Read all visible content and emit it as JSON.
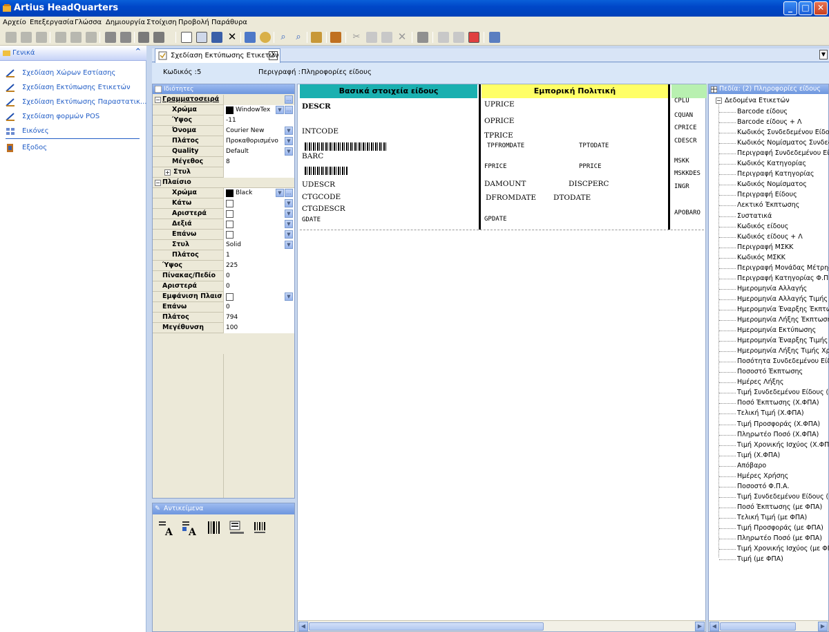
{
  "window": {
    "title": "Artius HeadQuarters",
    "min": "_",
    "max": "□",
    "close": "✕"
  },
  "menu": [
    "Αρχείο",
    "Επεξεργασία",
    "Γλώσσα",
    "Δημιουργία",
    "Στοίχιση",
    "Προβολή",
    "Παράθυρα"
  ],
  "left_panel": {
    "title": "Γενικά",
    "collapse": "^",
    "items": [
      {
        "label": "Σχεδίαση Χώρων Εστίασης",
        "icon": "design-icon"
      },
      {
        "label": "Σχεδίαση Εκτύπωσης Ετικετών",
        "icon": "design-icon"
      },
      {
        "label": "Σχεδίαση Εκτύπωσης Παραστατικ...",
        "icon": "design-icon"
      },
      {
        "label": "Σχεδίαση φορμών POS",
        "icon": "design-icon"
      },
      {
        "label": "Εικόνες",
        "icon": "grid-icon"
      },
      {
        "label": "Εξοδος",
        "icon": "exit-icon"
      }
    ]
  },
  "doc_tab": {
    "label": "Σχεδίαση Εκτύπωσης Ετικετών",
    "close": "X"
  },
  "info": {
    "code_label": "Κωδικός :",
    "code_value": "5",
    "desc_label": "Περιγραφή :",
    "desc_value": "Πληροφορίες είδους"
  },
  "properties": {
    "title": "Ιδιότητες",
    "font_section": "Γραμματοσειρά",
    "font_rows": [
      {
        "name": "Χρώμα",
        "value": "WindowTex",
        "swatch": "#000000",
        "type": "color"
      },
      {
        "name": "Ύψος",
        "value": "-11"
      },
      {
        "name": "Όνομα",
        "value": "Courier New",
        "type": "dropdown"
      },
      {
        "name": "Πλάτος",
        "value": "Προκαθορισμένο",
        "type": "dropdown"
      },
      {
        "name": "Quality",
        "value": "Default",
        "type": "dropdown"
      },
      {
        "name": "Μέγεθος",
        "value": "8"
      }
    ],
    "style_label": "Στυλ",
    "frame_section": "Πλαίσιο",
    "frame_rows": [
      {
        "name": "Χρώμα",
        "value": "Black",
        "swatch": "#000000",
        "type": "color"
      },
      {
        "name": "Κάτω",
        "value": "",
        "type": "checkbox"
      },
      {
        "name": "Αριστερά",
        "value": "",
        "type": "checkbox"
      },
      {
        "name": "Δεξιά",
        "value": "",
        "type": "checkbox"
      },
      {
        "name": "Επάνω",
        "value": "",
        "type": "checkbox"
      },
      {
        "name": "Στυλ",
        "value": "Solid",
        "type": "dropdown"
      },
      {
        "name": "Πλάτος",
        "value": "1"
      }
    ],
    "root_rows": [
      {
        "name": "Ύψος",
        "value": "225"
      },
      {
        "name": "Πίνακας/Πεδίο",
        "value": "0"
      },
      {
        "name": "Αριστερά",
        "value": "0"
      },
      {
        "name": "Εμφάνιση Πλαισί",
        "value": "",
        "type": "checkbox"
      },
      {
        "name": "Επάνω",
        "value": "0"
      },
      {
        "name": "Πλάτος",
        "value": "794"
      },
      {
        "name": "Μεγέθυνση",
        "value": "100"
      }
    ]
  },
  "objects_panel": {
    "title": "Αντικείμενα"
  },
  "label_design": {
    "band1": "Βασικά στοιχεία είδους",
    "band2": "Εμπορική Πολιτική",
    "fields1": [
      "DESCR",
      "INTCODE",
      "BARC",
      "UDESCR",
      "CTGCODE",
      "CTGDESCR",
      "GDATE"
    ],
    "fields2": [
      "UPRICE",
      "OPRICE",
      "TPRICE",
      "TPFROMDATE",
      "TPTODATE",
      "FPRICE",
      "PPRICE",
      "DAMOUNT",
      "DISCPERC",
      "DFROMDATE",
      "DTODATE",
      "GPDATE"
    ],
    "fields3": [
      "CPLU",
      "CQUAN",
      "CPRICE",
      "CDESCR",
      "MSKK",
      "MSKKDES",
      "INGR",
      "APOBARO"
    ]
  },
  "fields_pane": {
    "title": "Πεδία: (2) Πληροφορίες είδους",
    "root": "Δεδομένα Ετικετών",
    "items": [
      "Barcode είδους",
      "Barcode είδους + Λ",
      "Κωδικός Συνδεδεμένου Είδου",
      "Κωδικός Νομίσματος Συνδεδε",
      "Περιγραφή Συνδεδεμένου Εί",
      "Κωδικός Κατηγορίας",
      "Περιγραφή Κατηγορίας",
      "Κωδικός Νομίσματος",
      "Περιγραφή Είδους",
      "Λεκτικό Έκπτωσης",
      "Συστατικά",
      "Κωδικός είδους",
      "Κωδικός είδους + Λ",
      "Περιγραφή ΜΣΚΚ",
      "Κωδικός ΜΣΚΚ",
      "Περιγραφή Μονάδας Μέτρηση",
      "Περιγραφή Κατηγορίας Φ.Π.Α",
      "Ημερομηνία Αλλαγής",
      "Ημερομηνία Αλλαγής Τιμής",
      "Ημερομηνία Έναρξης Έκπτω",
      "Ημερομηνία Λήξης Έκπτωσης",
      "Ημερομηνία Εκτύπωσης",
      "Ημερομηνία Έναρξης Τιμής Χ",
      "Ημερομηνία Λήξης Τιμής Χρο",
      "Ποσότητα Συνδεδεμένου Είδ",
      "Ποσοστό Έκπτωσης",
      "Ημέρες Λήξης",
      "Τιμή Συνδεδεμένου Είδους (Χ",
      "Ποσό Έκπτωσης (Χ.ΦΠΑ)",
      "Τελική Τιμή (Χ.ΦΠΑ)",
      "Τιμή Προσφοράς (Χ.ΦΠΑ)",
      "Πληρωτέο Ποσό (Χ.ΦΠΑ)",
      "Τιμή Χρονικής Ισχύος (Χ.ΦΠ",
      "Τιμή (Χ.ΦΠΑ)",
      "Απόβαρο",
      "Ημέρες Χρήσης",
      "Ποσοστό Φ.Π.Α.",
      "Τιμή Συνδεδεμένου Είδους (μ",
      "Ποσό Έκπτωσης (με ΦΠΑ)",
      "Τελική Τιμή (με ΦΠΑ)",
      "Τιμή Προσφοράς (με ΦΠΑ)",
      "Πληρωτέο Ποσό (με ΦΠΑ)",
      "Τιμή Χρονικής Ισχύος (με ΦΠ",
      "Τιμή (με ΦΠΑ)"
    ]
  },
  "colors": {
    "band1": "#1ab0b0",
    "band2": "#ffff66",
    "band3": "#b8f0b0",
    "link": "#215dc6"
  }
}
